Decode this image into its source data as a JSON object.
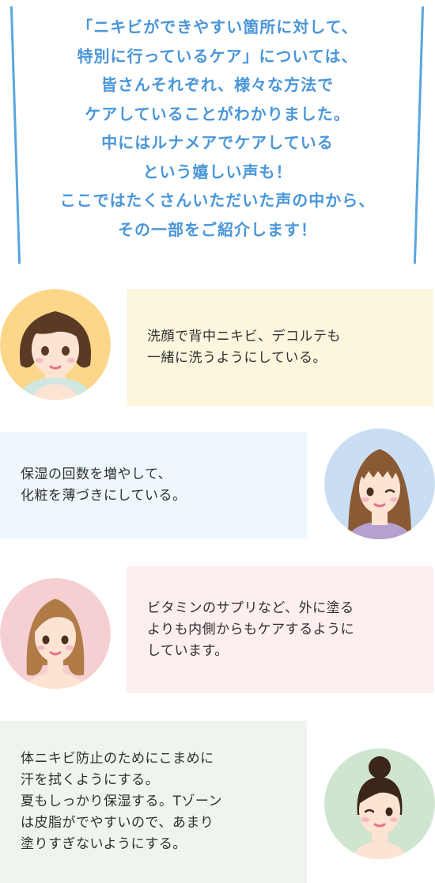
{
  "intro": {
    "lines": [
      "「ニキビができやすい箇所に対して、",
      "特別に行っているケア」については、",
      "皆さんそれぞれ、様々な方法で",
      "ケアしていることがわかりました。",
      "中にはルナメアでケアしている",
      "という嬉しい声も！",
      "ここではたくさんいただいた声の中から、",
      "その一部をご紹介します！"
    ]
  },
  "testimonials": [
    {
      "avatar_icon": "woman-short-brown-hair-icon",
      "bubble_color": "#fdf6de",
      "avatar_bg": "#fcd78a",
      "lines": [
        "洗顔で背中ニキビ、デコルテも",
        "一緒に洗うようにしている。"
      ]
    },
    {
      "avatar_icon": "woman-long-hair-bangs-winking-icon",
      "bubble_color": "#eef7fc",
      "avatar_bg": "#c9def3",
      "lines": [
        "保湿の回数を増やして、",
        "化粧を薄づきにしている。"
      ]
    },
    {
      "avatar_icon": "woman-long-light-brown-hair-icon",
      "bubble_color": "#fdeff0",
      "avatar_bg": "#f6cfd2",
      "lines": [
        "ビタミンのサプリなど、外に塗る",
        "よりも内側からもケアするように",
        "しています。"
      ]
    },
    {
      "avatar_icon": "woman-hair-bun-winking-icon",
      "bubble_color": "#eff5ee",
      "avatar_bg": "#cfe5cf",
      "lines": [
        "体ニキビ防止のためにこまめに",
        "汗を拭くようにする。",
        "夏もしっかり保湿する。Tゾーン",
        "は皮脂がでやすいので、あまり",
        "塗りすぎないようにする。"
      ]
    }
  ]
}
